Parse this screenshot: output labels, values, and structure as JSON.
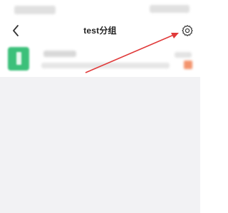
{
  "header": {
    "title": "test分组"
  },
  "icons": {
    "back": "back-chevron-icon",
    "settings": "gear-icon"
  },
  "colors": {
    "avatar": "#3cc07a",
    "badge": "#f07a4a",
    "annotation_arrow": "#e03a3a",
    "background_area": "#f2f2f4"
  }
}
